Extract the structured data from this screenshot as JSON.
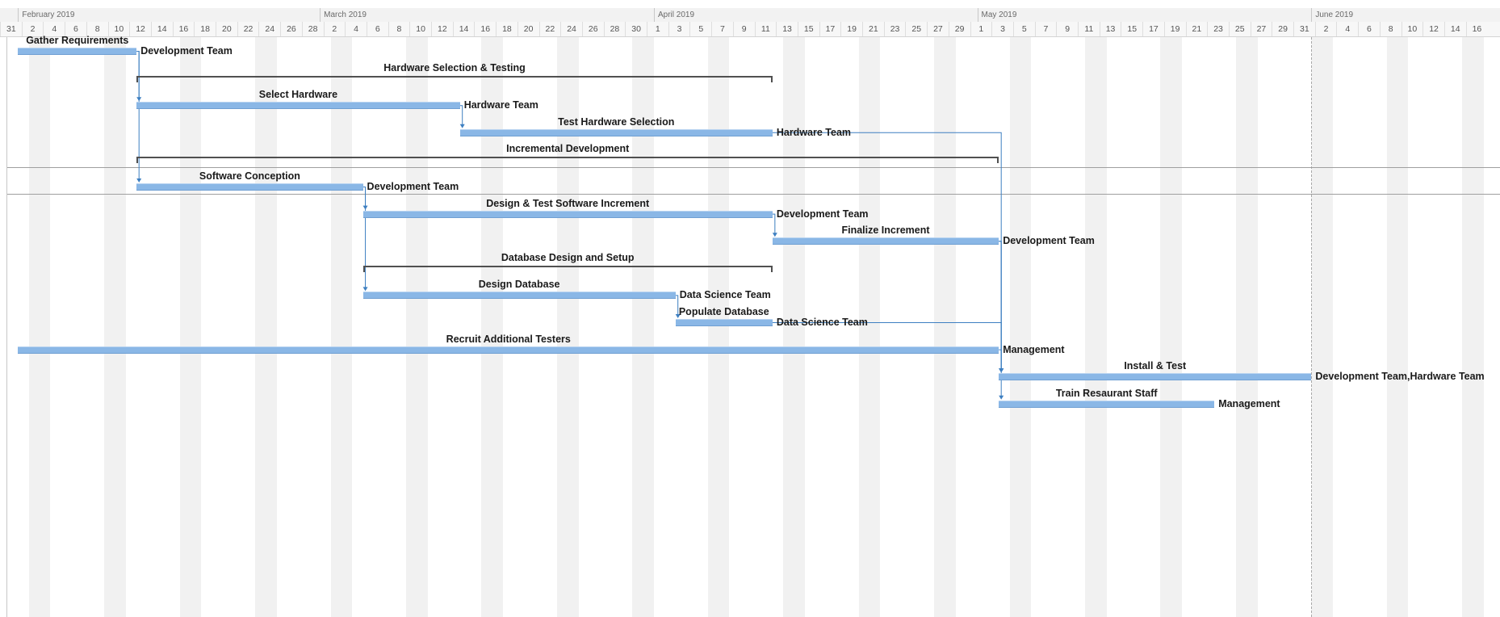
{
  "timeline": {
    "start_date": "2019-01-31",
    "months": [
      {
        "label": "February 2019",
        "date": "2019-02-01"
      },
      {
        "label": "March 2019",
        "date": "2019-03-01"
      },
      {
        "label": "April 2019",
        "date": "2019-04-01"
      },
      {
        "label": "May 2019",
        "date": "2019-05-01"
      },
      {
        "label": "June 2019",
        "date": "2019-06-01"
      }
    ],
    "day_ticks": [
      "31",
      "2",
      "4",
      "6",
      "8",
      "10",
      "12",
      "14",
      "16",
      "18",
      "20",
      "22",
      "24",
      "26",
      "28",
      "2",
      "4",
      "6",
      "8",
      "10",
      "12",
      "14",
      "16",
      "18",
      "20",
      "22",
      "24",
      "26",
      "28",
      "30",
      "1",
      "3",
      "5",
      "7",
      "9",
      "11",
      "13",
      "15",
      "17",
      "19",
      "21",
      "23",
      "25",
      "27",
      "29",
      "1",
      "3",
      "5",
      "7",
      "9",
      "11",
      "13",
      "15",
      "17",
      "19",
      "21",
      "23",
      "25",
      "27",
      "29",
      "31",
      "2",
      "4",
      "6",
      "8",
      "10",
      "12",
      "14",
      "16"
    ],
    "today_marker": "2019-06-01"
  },
  "tasks": [
    {
      "id": "gather-requirements",
      "name": "Gather Requirements",
      "type": "task",
      "start": "2019-02-01",
      "end": "2019-02-12",
      "resource": "Development Team"
    },
    {
      "id": "hardware-selection-testing",
      "name": "Hardware Selection & Testing",
      "type": "summary",
      "start": "2019-02-12",
      "end": "2019-04-12",
      "resource": ""
    },
    {
      "id": "select-hardware",
      "name": "Select Hardware",
      "type": "task",
      "start": "2019-02-12",
      "end": "2019-03-14",
      "resource": "Hardware Team"
    },
    {
      "id": "test-hardware-selection",
      "name": "Test Hardware Selection",
      "type": "task",
      "start": "2019-03-14",
      "end": "2019-04-12",
      "resource": "Hardware Team"
    },
    {
      "id": "incremental-development",
      "name": "Incremental Development",
      "type": "summary",
      "start": "2019-02-12",
      "end": "2019-05-03",
      "resource": ""
    },
    {
      "id": "software-conception",
      "name": "Software Conception",
      "type": "task",
      "start": "2019-02-12",
      "end": "2019-03-05",
      "resource": "Development Team"
    },
    {
      "id": "design-test-software-increment",
      "name": "Design & Test Software Increment",
      "type": "task",
      "start": "2019-03-05",
      "end": "2019-04-12",
      "resource": "Development Team"
    },
    {
      "id": "finalize-increment",
      "name": "Finalize Increment",
      "type": "task",
      "start": "2019-04-12",
      "end": "2019-05-03",
      "resource": "Development Team"
    },
    {
      "id": "database-design-setup",
      "name": "Database Design and Setup",
      "type": "summary",
      "start": "2019-03-05",
      "end": "2019-04-12",
      "resource": ""
    },
    {
      "id": "design-database",
      "name": "Design Database",
      "type": "task",
      "start": "2019-03-05",
      "end": "2019-04-03",
      "resource": "Data Science Team"
    },
    {
      "id": "populate-database",
      "name": "Populate Database",
      "type": "task",
      "start": "2019-04-03",
      "end": "2019-04-12",
      "resource": "Data Science Team"
    },
    {
      "id": "recruit-additional-testers",
      "name": "Recruit Additional Testers",
      "type": "task",
      "start": "2019-02-01",
      "end": "2019-05-03",
      "resource": "Management"
    },
    {
      "id": "install-test",
      "name": "Install & Test",
      "type": "task",
      "start": "2019-05-03",
      "end": "2019-06-01",
      "resource": "Development Team,Hardware Team"
    },
    {
      "id": "train-restaurant-staff",
      "name": "Train Resaurant Staff",
      "type": "task",
      "start": "2019-05-03",
      "end": "2019-05-23",
      "resource": "Management"
    }
  ],
  "dependencies": [
    [
      "gather-requirements",
      "select-hardware"
    ],
    [
      "gather-requirements",
      "software-conception"
    ],
    [
      "select-hardware",
      "test-hardware-selection"
    ],
    [
      "software-conception",
      "design-test-software-increment"
    ],
    [
      "software-conception",
      "design-database"
    ],
    [
      "design-test-software-increment",
      "finalize-increment"
    ],
    [
      "design-database",
      "populate-database"
    ],
    [
      "test-hardware-selection",
      "install-test"
    ],
    [
      "finalize-increment",
      "install-test"
    ],
    [
      "populate-database",
      "install-test"
    ],
    [
      "recruit-additional-testers",
      "install-test"
    ],
    [
      "finalize-increment",
      "train-restaurant-staff"
    ]
  ],
  "colors": {
    "task_bar": "#8ab7e6",
    "summary_bar": "#505050",
    "dependency_line": "#3d7fc1",
    "weekend_shade": "#f1f1f1",
    "text": "#1a1a1a"
  }
}
